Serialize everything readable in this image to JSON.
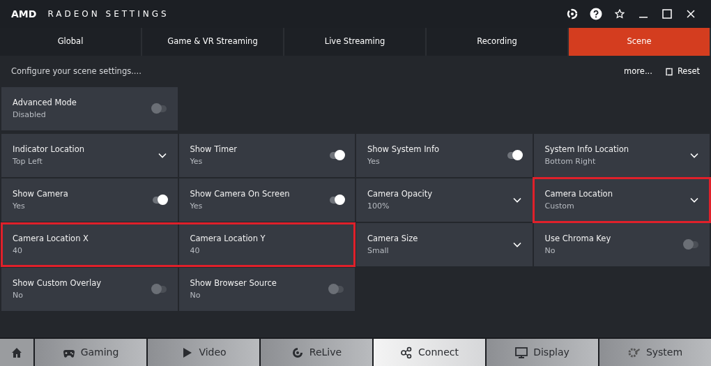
{
  "window": {
    "brand": "AMD",
    "title": "RADEON SETTINGS"
  },
  "tabs": [
    {
      "label": "Global",
      "selected": false
    },
    {
      "label": "Game & VR Streaming",
      "selected": false
    },
    {
      "label": "Live Streaming",
      "selected": false
    },
    {
      "label": "Recording",
      "selected": false
    },
    {
      "label": "Scene",
      "selected": true
    }
  ],
  "subheader": {
    "description": "Configure your scene settings....",
    "more": "more...",
    "reset": "Reset"
  },
  "advanced_mode": {
    "label": "Advanced Mode",
    "value": "Disabled",
    "on": false
  },
  "tile_rows": [
    [
      {
        "kind": "dropdown",
        "label": "Indicator Location",
        "value": "Top Left",
        "highlighted": false
      },
      {
        "kind": "toggle",
        "label": "Show Timer",
        "value": "Yes",
        "on": true,
        "highlighted": false
      },
      {
        "kind": "toggle",
        "label": "Show System Info",
        "value": "Yes",
        "on": true,
        "highlighted": false
      },
      {
        "kind": "dropdown",
        "label": "System Info Location",
        "value": "Bottom Right",
        "highlighted": false
      }
    ],
    [
      {
        "kind": "toggle",
        "label": "Show Camera",
        "value": "Yes",
        "on": true,
        "highlighted": false
      },
      {
        "kind": "toggle",
        "label": "Show Camera On Screen",
        "value": "Yes",
        "on": true,
        "highlighted": false
      },
      {
        "kind": "dropdown",
        "label": "Camera Opacity",
        "value": "100%",
        "highlighted": false
      },
      {
        "kind": "dropdown",
        "label": "Camera Location",
        "value": "Custom",
        "highlighted": true
      }
    ],
    [
      {
        "kind": "value",
        "label": "Camera Location X",
        "value": "40",
        "highlighted": true
      },
      {
        "kind": "value",
        "label": "Camera Location Y",
        "value": "40",
        "highlighted": true
      },
      {
        "kind": "dropdown",
        "label": "Camera Size",
        "value": "Small",
        "highlighted": false
      },
      {
        "kind": "toggle",
        "label": "Use Chroma Key",
        "value": "No",
        "on": false,
        "highlighted": false
      }
    ],
    [
      {
        "kind": "toggle",
        "label": "Show Custom Overlay",
        "value": "No",
        "on": false,
        "highlighted": false
      },
      {
        "kind": "toggle",
        "label": "Show Browser Source",
        "value": "No",
        "on": false,
        "highlighted": false
      }
    ]
  ],
  "bottom_nav": [
    {
      "kind": "home",
      "selected": false
    },
    {
      "kind": "gaming",
      "label": "Gaming",
      "selected": false
    },
    {
      "kind": "video",
      "label": "Video",
      "selected": false
    },
    {
      "kind": "relive",
      "label": "ReLive",
      "selected": false
    },
    {
      "kind": "connect",
      "label": "Connect",
      "selected": true
    },
    {
      "kind": "display",
      "label": "Display",
      "selected": false
    },
    {
      "kind": "system",
      "label": "System",
      "selected": false
    }
  ]
}
